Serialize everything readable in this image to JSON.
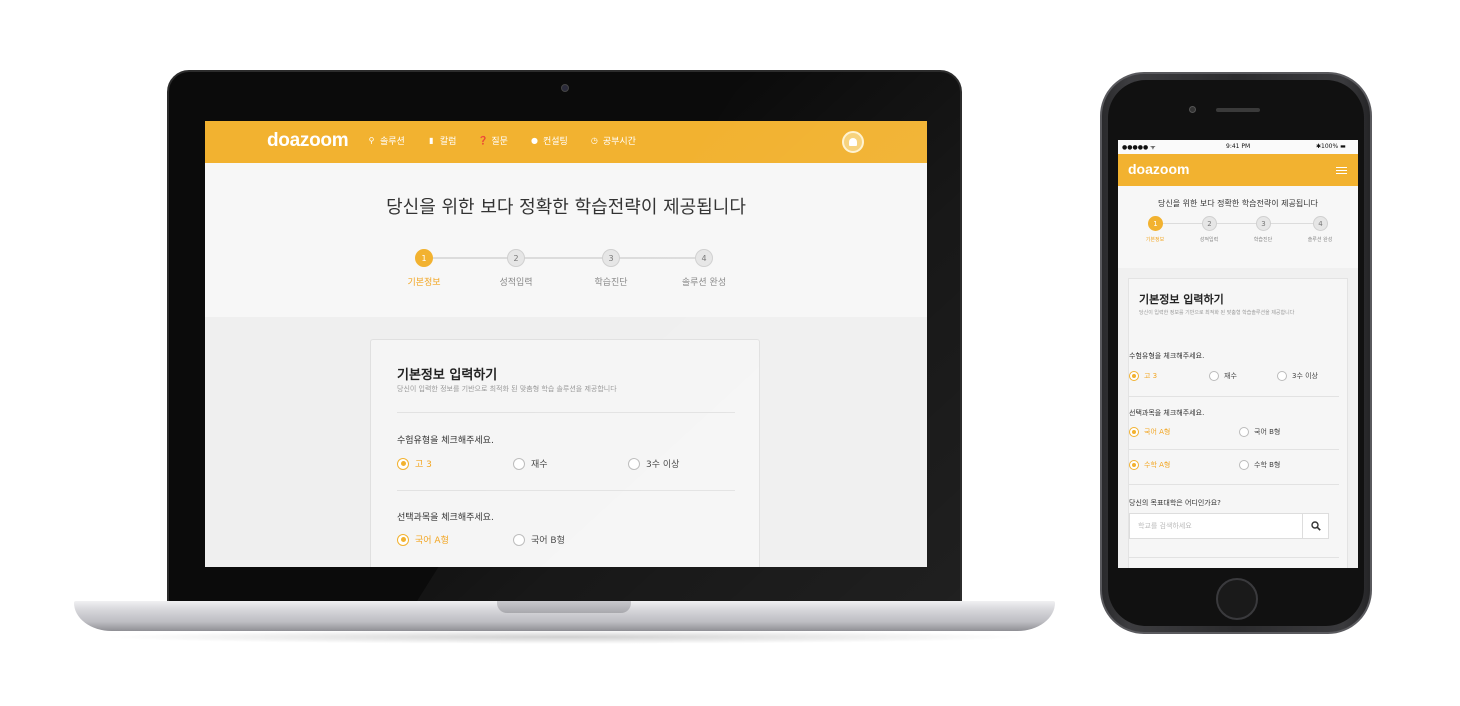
{
  "brand": {
    "name": "doazoom",
    "accent": "#f2b230"
  },
  "laptop": {
    "nav": [
      {
        "label": "솔루션",
        "icon": "pin-icon"
      },
      {
        "label": "칼럼",
        "icon": "bookmark-icon"
      },
      {
        "label": "질문",
        "icon": "question-icon"
      },
      {
        "label": "컨설팅",
        "icon": "chat-icon"
      },
      {
        "label": "공부시간",
        "icon": "clock-icon"
      }
    ],
    "hero_title": "당신을 위한 보다 정확한 학습전략이 제공됩니다",
    "steps": [
      {
        "num": "1",
        "label": "기본정보"
      },
      {
        "num": "2",
        "label": "성적입력"
      },
      {
        "num": "3",
        "label": "학습진단"
      },
      {
        "num": "4",
        "label": "솔루션 완성"
      }
    ],
    "card": {
      "title": "기본정보 입력하기",
      "subtitle": "당신이 입력한 정보를 기반으로 최적화 된 맞춤형 학습 솔루션을 제공합니다",
      "q1": "수험유형을 체크해주세요.",
      "q1_options": [
        "고 3",
        "재수",
        "3수 이상"
      ],
      "q2": "선택과목을 체크해주세요.",
      "q2_options": [
        "국어 A형",
        "국어 B형"
      ]
    }
  },
  "phone": {
    "status": {
      "carrier": "●●●●● ᯤ",
      "time": "9:41 PM",
      "battery": "✱100% ▬"
    },
    "hero_title": "당신을 위한 보다 정확한 학습전략이 제공됩니다",
    "steps": [
      {
        "num": "1",
        "label": "기본정보"
      },
      {
        "num": "2",
        "label": "성적입력"
      },
      {
        "num": "3",
        "label": "학습진단"
      },
      {
        "num": "4",
        "label": "솔루션 완성"
      }
    ],
    "card": {
      "title": "기본정보 입력하기",
      "subtitle": "당신이 입력한 정보를 기반으로 최적화 된 맞춤형 학습솔루션을 제공합니다",
      "q1": "수험유형을 체크해주세요.",
      "q1_options": [
        "고 3",
        "재수",
        "3수 이상"
      ],
      "q2": "선택과목을 체크해주세요.",
      "q2_row1": [
        "국어 A형",
        "국어 B형"
      ],
      "q2_row2": [
        "수학 A형",
        "수학 B형"
      ],
      "q3": "당신의 목표대학은 어디인가요?",
      "search_placeholder": "학교를 검색하세요"
    }
  }
}
